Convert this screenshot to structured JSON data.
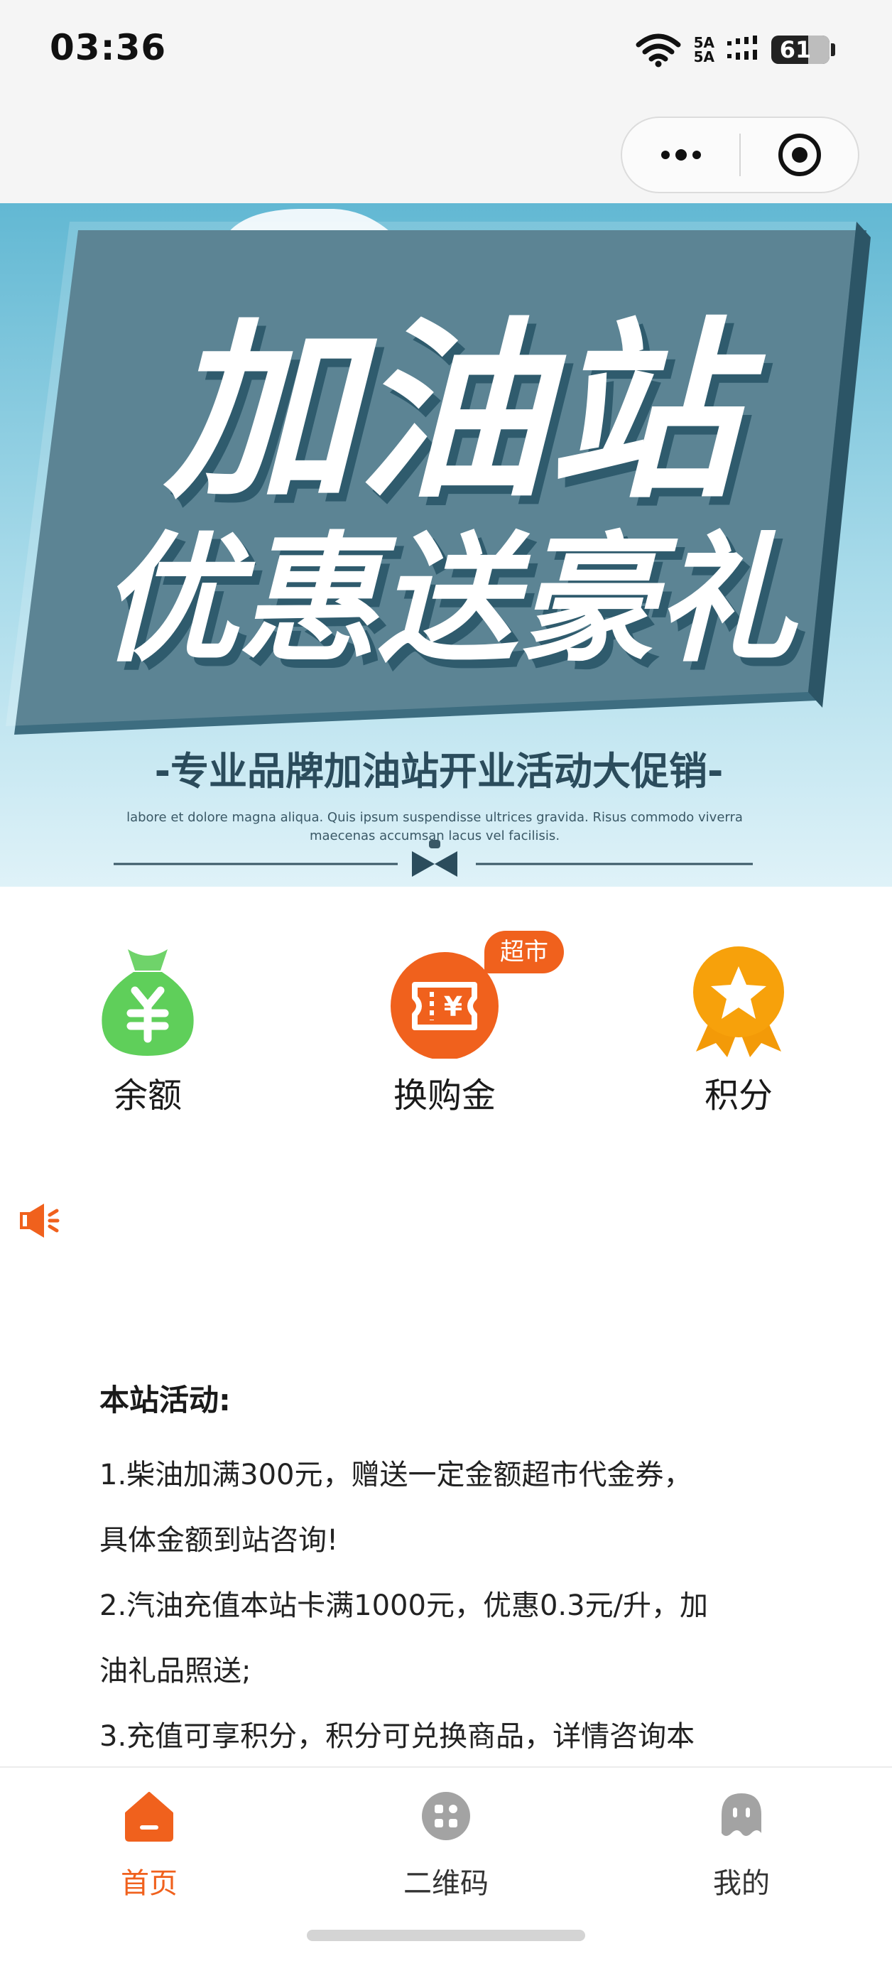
{
  "status_bar": {
    "time": "03:36",
    "network_top": "5A",
    "network_bottom": "5A",
    "battery": "61",
    "icons": [
      "wifi-icon",
      "signal-icon",
      "battery-icon"
    ]
  },
  "capsule": {
    "more_icon": "more-dots-icon",
    "close_icon": "target-circle-icon"
  },
  "banner": {
    "headline_line1": "加油站",
    "headline_line2": "优惠送豪礼",
    "subtitle": "-专业品牌加油站开业活动大促销-",
    "small_text_line1": "labore et dolore magna aliqua. Quis ipsum suspendisse ultrices gravida. Risus commodo viverra",
    "small_text_line2": "maecenas accumsan lacus vel facilisis."
  },
  "shortcuts": [
    {
      "label": "余额",
      "icon": "money-bag-icon",
      "color": "#5fcf5a"
    },
    {
      "label": "换购金",
      "icon": "coupon-icon",
      "color": "#f0611d",
      "badge": "超市"
    },
    {
      "label": "积分",
      "icon": "medal-star-icon",
      "color": "#f7a10b"
    }
  ],
  "notice": {
    "icon": "speaker-icon",
    "color": "#f0611d"
  },
  "activity": {
    "title": "本站活动:",
    "lines": [
      "1.柴油加满300元，赠送一定金额超市代金券，",
      "具体金额到站咨询!",
      "2.汽油充值本站卡满1000元，优惠0.3元/升，加",
      "油礼品照送;",
      "3.充值可享积分，积分可兑换商品，详情咨询本"
    ]
  },
  "tabbar": {
    "active_color": "#f0611d",
    "inactive_color": "#333333",
    "tabs": [
      {
        "label": "首页",
        "icon": "home-icon",
        "active": true
      },
      {
        "label": "二维码",
        "icon": "qrcode-grid-icon",
        "active": false
      },
      {
        "label": "我的",
        "icon": "profile-ghost-icon",
        "active": false
      }
    ]
  }
}
